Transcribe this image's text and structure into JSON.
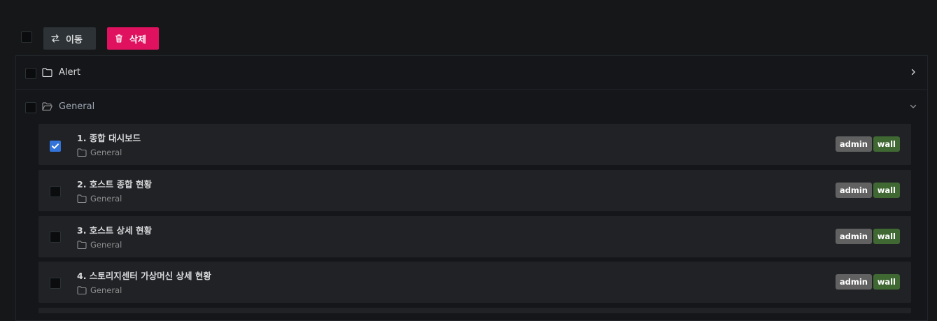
{
  "toolbar": {
    "move_label": "이동",
    "delete_label": "삭제"
  },
  "folders": [
    {
      "name": "Alert",
      "expanded": false
    },
    {
      "name": "General",
      "expanded": true
    }
  ],
  "dashboards": [
    {
      "title": "1. 종합 대시보드",
      "folder": "General",
      "checked": true,
      "tags": [
        "admin",
        "wall"
      ]
    },
    {
      "title": "2. 호스트 종합 현황",
      "folder": "General",
      "checked": false,
      "tags": [
        "admin",
        "wall"
      ]
    },
    {
      "title": "3. 호스트 상세 현황",
      "folder": "General",
      "checked": false,
      "tags": [
        "admin",
        "wall"
      ]
    },
    {
      "title": "4. 스토리지센터 가상머신 상세 현황",
      "folder": "General",
      "checked": false,
      "tags": [
        "admin",
        "wall"
      ]
    }
  ],
  "colors": {
    "accent": "#3274d9",
    "danger": "#e0115f",
    "tag_admin": "#616161",
    "tag_wall": "#3f6833"
  },
  "icons": {
    "move": "arrows-exchange-icon",
    "delete": "trash-icon",
    "folder": "folder-icon",
    "folder_open": "folder-open-icon",
    "chevron_right": "chevron-right-icon",
    "chevron_down": "chevron-down-icon"
  }
}
